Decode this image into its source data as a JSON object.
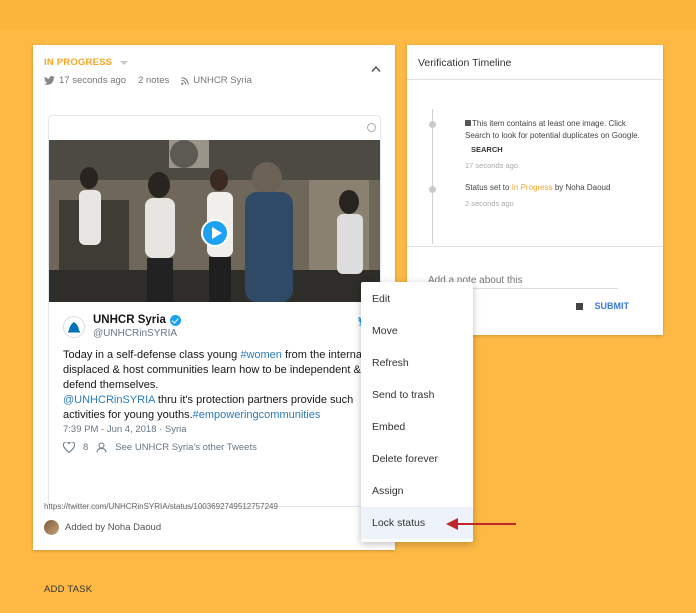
{
  "item": {
    "status": "IN PROGRESS",
    "time_ago": "17 seconds ago",
    "notes": "2 notes",
    "source": "UNHCR Syria",
    "url": "https://twitter.com/UNHCRinSYRIA/status/1003692749512757249",
    "added_by": "Added by Noha Daoud"
  },
  "tweet": {
    "author_name": "UNHCR Syria",
    "handle": "@UNHCRinSYRIA",
    "text_1": "Today in a self-defense class young ",
    "hashtag_1": "#women",
    "text_2": " from the internally displaced & host communities learn how to be independent & defend themselves.",
    "mention": "@UNHCRinSYRIA",
    "text_3": " thru it's protection partners provide such activities for young youths.",
    "hashtag_2": "#empoweringcommunities",
    "time": "7:39 PM - Jun 4, 2018 · Syria",
    "likes": "8",
    "other_tweets": "See UNHCR Syria's other Tweets"
  },
  "timeline": {
    "title": "Verification Timeline",
    "entry1_text": "This item contains at least one image. Click Search to look for potential duplicates on Google.",
    "entry1_action": "SEARCH",
    "entry1_time": "17 seconds ago",
    "entry2_prefix": "Status set to ",
    "entry2_status": "In Progress",
    "entry2_suffix": " by Noha Daoud",
    "entry2_time": "2 seconds ago",
    "note_placeholder": "Add a note about this",
    "submit_label": "SUBMIT"
  },
  "menu": {
    "items": [
      "Edit",
      "Move",
      "Refresh",
      "Send to trash",
      "Embed",
      "Delete forever",
      "Assign",
      "Lock status"
    ]
  },
  "footer": {
    "add_task": "ADD TASK"
  },
  "colors": {
    "background": "#fdb944",
    "status": "#f5a623",
    "link": "#2b7bb9",
    "submit": "#3b7bd9",
    "arrow": "#c0272d"
  }
}
